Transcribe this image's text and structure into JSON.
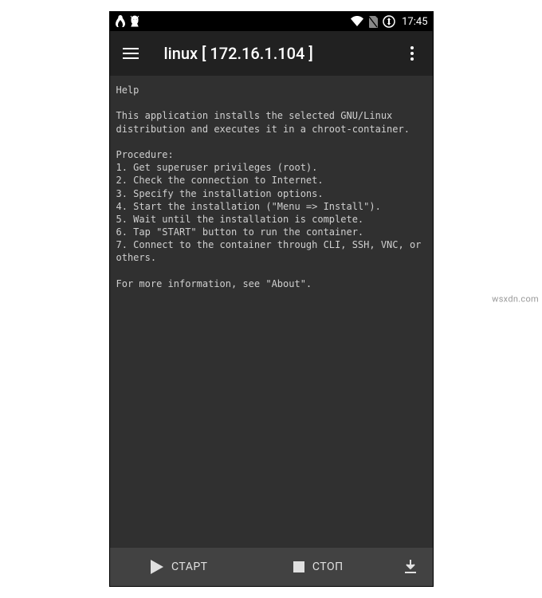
{
  "statusbar": {
    "time": "17:45"
  },
  "appbar": {
    "title": "linux  [ 172.16.1.104 ]"
  },
  "help": {
    "heading": "Help",
    "intro": "This application installs the selected GNU/Linux distribution and executes it in a chroot-container.",
    "procedure_label": "Procedure:",
    "steps": [
      "1. Get superuser privileges (root).",
      "2. Check the connection to Internet.",
      "3. Specify the installation options.",
      "4. Start the installation (\"Menu => Install\").",
      "5. Wait until the installation is complete.",
      "6. Tap \"START\" button to run the container.",
      "7. Connect to the container through CLI, SSH, VNC, or others."
    ],
    "footer": "For more information, see \"About\"."
  },
  "bottombar": {
    "start_label": "СТАРТ",
    "stop_label": "СТОП"
  },
  "watermark": "wsxdn.com"
}
